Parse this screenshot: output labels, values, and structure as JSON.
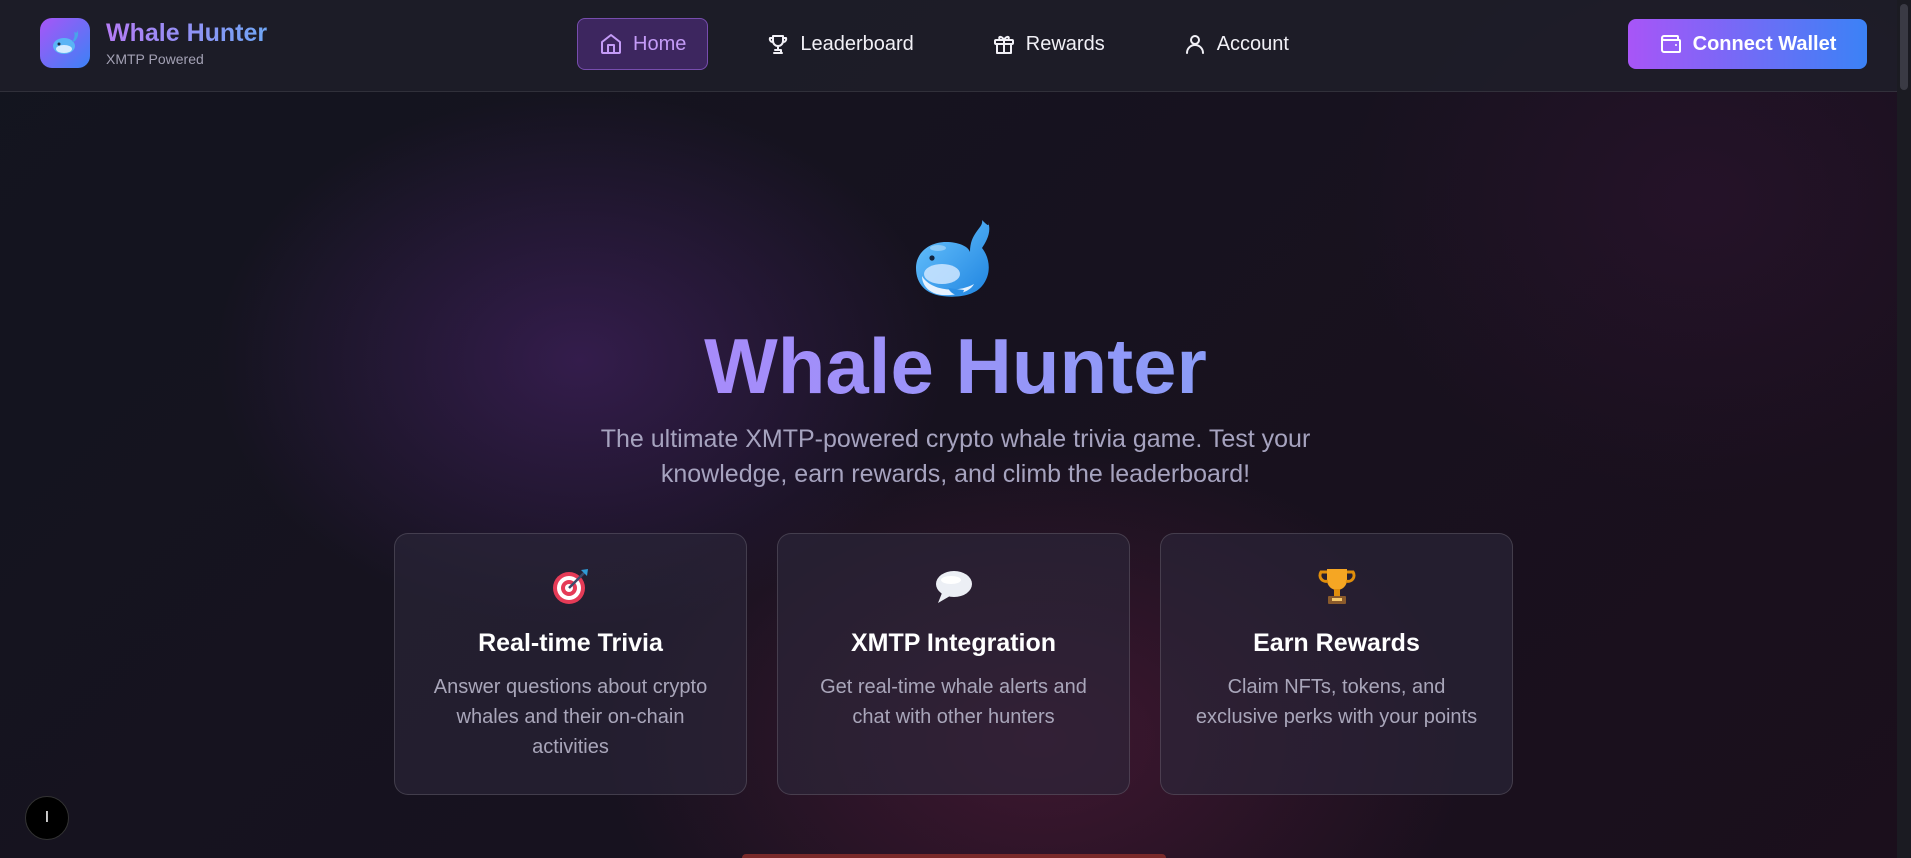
{
  "brand": {
    "title": "Whale Hunter",
    "subtitle": "XMTP Powered",
    "logo_icon": "whale-icon"
  },
  "nav": {
    "items": [
      {
        "label": "Home",
        "icon": "home-icon",
        "active": true
      },
      {
        "label": "Leaderboard",
        "icon": "trophy-icon",
        "active": false
      },
      {
        "label": "Rewards",
        "icon": "gift-icon",
        "active": false
      },
      {
        "label": "Account",
        "icon": "user-icon",
        "active": false
      }
    ]
  },
  "header": {
    "connect_label": "Connect Wallet",
    "connect_icon": "wallet-icon"
  },
  "hero": {
    "emoji": "🐳",
    "title": "Whale Hunter",
    "description": "The ultimate XMTP-powered crypto whale trivia game. Test your knowledge, earn rewards, and climb the leaderboard!"
  },
  "features": [
    {
      "icon": "🎯",
      "title": "Real-time Trivia",
      "description": "Answer questions about crypto whales and their on-chain activities"
    },
    {
      "icon": "💬",
      "title": "XMTP Integration",
      "description": "Get real-time whale alerts and chat with other hunters"
    },
    {
      "icon": "🏆",
      "title": "Earn Rewards",
      "description": "Claim NFTs, tokens, and exclusive perks with your points"
    }
  ],
  "floating_button": {
    "label": "I"
  },
  "colors": {
    "accent_purple": "#a855f7",
    "accent_blue": "#3b82f6",
    "background": "#15131d"
  }
}
